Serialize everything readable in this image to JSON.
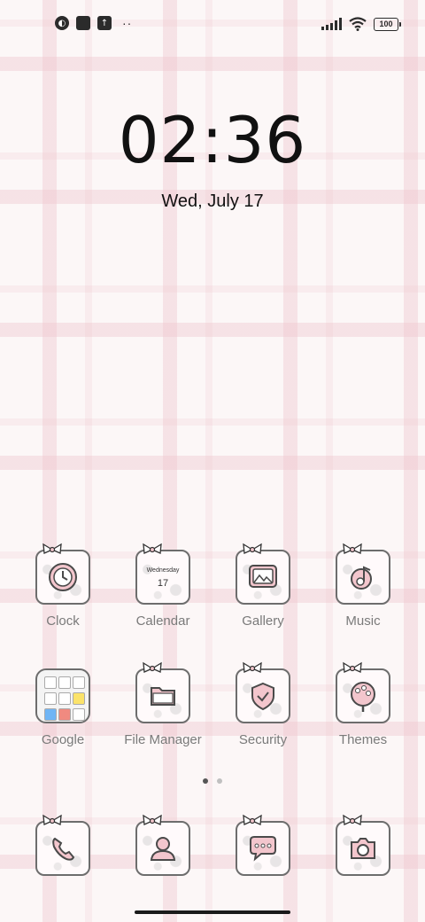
{
  "status_bar": {
    "left_icons": [
      "app-notification-icon",
      "square-notification-icon",
      "upload-notification-icon"
    ],
    "more_dots": "··",
    "battery_level": "100",
    "icons_right": [
      "signal-icon",
      "wifi-icon",
      "battery-icon"
    ]
  },
  "lockscreen": {
    "time": "02:36",
    "date": "Wed, July 17"
  },
  "apps_row1": [
    {
      "label": "Clock",
      "icon": "clock-icon"
    },
    {
      "label": "Calendar",
      "icon": "calendar-icon",
      "day_name": "Wednesday",
      "day_number": "17"
    },
    {
      "label": "Gallery",
      "icon": "gallery-icon"
    },
    {
      "label": "Music",
      "icon": "music-icon"
    }
  ],
  "apps_row2": [
    {
      "label": "Google",
      "icon": "google-folder-icon"
    },
    {
      "label": "File Manager",
      "icon": "folder-icon"
    },
    {
      "label": "Security",
      "icon": "shield-check-icon"
    },
    {
      "label": "Themes",
      "icon": "palette-icon"
    }
  ],
  "dock": [
    {
      "icon": "phone-icon"
    },
    {
      "icon": "contacts-icon"
    },
    {
      "icon": "messages-icon"
    },
    {
      "icon": "camera-icon"
    }
  ],
  "page_indicator": {
    "pages": 2,
    "active_page": 1
  },
  "colors": {
    "background": "#fcf7f7",
    "plaid_pink": "#eec4cc",
    "icon_pink": "#f3c6cd",
    "icon_outline": "#4a4a4a",
    "label_gray": "#7a7a7a"
  }
}
